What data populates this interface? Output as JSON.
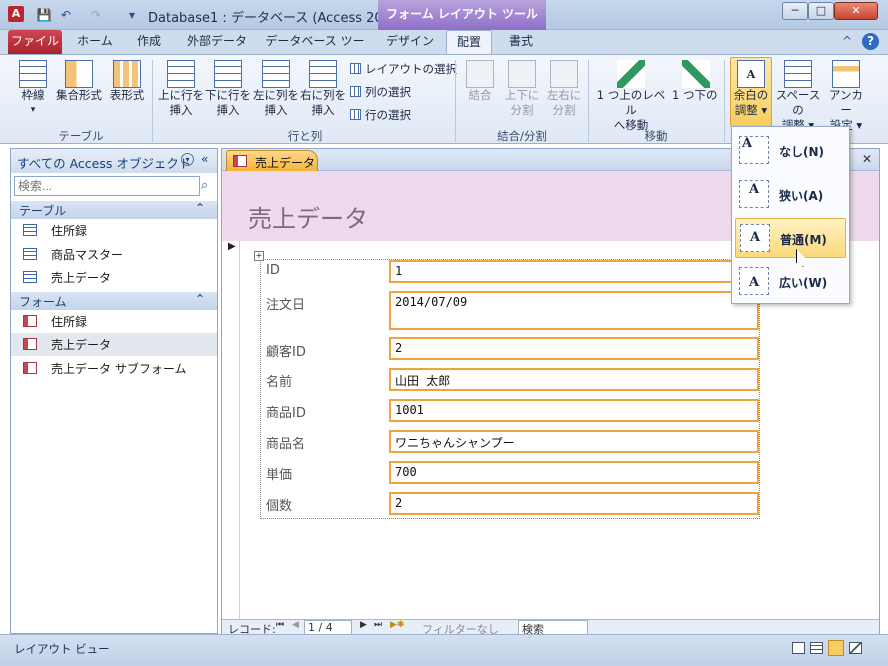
{
  "window": {
    "app_icon": "A",
    "title": "Database1 : データベース (Access 200...",
    "context_tab": "フォーム レイアウト ツール",
    "minimize": "─",
    "maximize": "□",
    "close": "✕"
  },
  "qat": {
    "save": "💾",
    "undo": "↶",
    "redo": "↷",
    "customize": "▾"
  },
  "tabs": [
    "ファイル",
    "ホーム",
    "作成",
    "外部データ",
    "データベース ツール",
    "デザイン",
    "配置",
    "書式"
  ],
  "ribbon": {
    "groups": [
      "テーブル",
      "行と列",
      "結合/分割",
      "移動"
    ],
    "table": [
      {
        "line1": "枠線",
        "line2": "▾"
      },
      {
        "line1": "集合形式",
        "line2": ""
      },
      {
        "line1": "表形式",
        "line2": ""
      }
    ],
    "rows_cols": [
      {
        "line1": "上に行を",
        "line2": "挿入"
      },
      {
        "line1": "下に行を",
        "line2": "挿入"
      },
      {
        "line1": "左に列を",
        "line2": "挿入"
      },
      {
        "line1": "右に列を",
        "line2": "挿入"
      }
    ],
    "select": [
      "レイアウトの選択",
      "列の選択",
      "行の選択"
    ],
    "merge": [
      {
        "line1": "結合",
        "line2": ""
      },
      {
        "line1": "上下に",
        "line2": "分割"
      },
      {
        "line1": "左右に",
        "line2": "分割"
      }
    ],
    "move": [
      {
        "line1": "1 つ上のレベル",
        "line2": "へ移動"
      },
      {
        "line1": "1 つ下のレベル",
        "line2": "へ移動"
      }
    ],
    "position": [
      {
        "line1": "余白の",
        "line2": "調整 ▾"
      },
      {
        "line1": "スペースの",
        "line2": "調整 ▾"
      },
      {
        "line1": "アンカー",
        "line2": "設定 ▾"
      }
    ],
    "help_icon": "?",
    "collapse_icon": "^"
  },
  "nav": {
    "title": "すべての Access オブジェクト",
    "search_placeholder": "検索...",
    "search_icon": "search-icon",
    "sections": [
      {
        "name": "テーブル",
        "items": [
          "住所録",
          "商品マスター",
          "売上データ"
        ]
      },
      {
        "name": "フォーム",
        "items": [
          "住所録",
          "売上データ",
          "売上データ サブフォーム"
        ]
      }
    ]
  },
  "document": {
    "tab": "売上データ",
    "title": "売上データ",
    "close": "✕",
    "fields": [
      {
        "label": "ID",
        "value": "1"
      },
      {
        "label": "注文日",
        "value": "2014/07/09"
      },
      {
        "label": "顧客ID",
        "value": "2"
      },
      {
        "label": "名前",
        "value": "山田 太郎"
      },
      {
        "label": "商品ID",
        "value": "1001"
      },
      {
        "label": "商品名",
        "value": "ワニちゃんシャンプー"
      },
      {
        "label": "単価",
        "value": "700"
      },
      {
        "label": "個数",
        "value": "2"
      }
    ]
  },
  "record_nav": {
    "label": "レコード:",
    "first": "⏮",
    "prev": "◀",
    "position": "1 / 4",
    "next": "▶",
    "last": "⏭",
    "new": "▶✱",
    "filter": "フィルターなし",
    "search": "検索"
  },
  "status": {
    "text": "レイアウト ビュー"
  },
  "dropdown": {
    "items": [
      {
        "label": "なし(N)"
      },
      {
        "label": "狭い(A)"
      },
      {
        "label": "普通(M)"
      },
      {
        "label": "広い(W)"
      }
    ],
    "icon_glyph": "A"
  },
  "colors": {
    "accent_orange": "#f0a43e",
    "file_tab": "#b8232f",
    "context_tab": "#8f6fc8",
    "form_header": "#eedaec"
  }
}
